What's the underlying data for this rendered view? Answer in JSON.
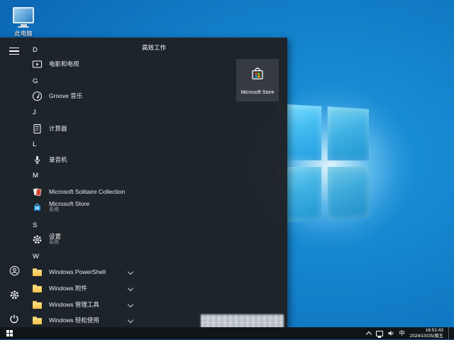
{
  "desktop": {
    "this_pc_label": "此电脑"
  },
  "start_menu": {
    "sections": [
      "D",
      "G",
      "J",
      "L",
      "M",
      "S",
      "W"
    ],
    "apps": {
      "movies": {
        "label": "电影和电视"
      },
      "groove": {
        "label": "Groove 音乐"
      },
      "calculator": {
        "label": "计算器"
      },
      "recorder": {
        "label": "录音机"
      },
      "solitaire": {
        "label": "Microsoft Solitaire Collection"
      },
      "store": {
        "label": "Microsoft Store",
        "sub": "系统"
      },
      "settings": {
        "label": "设置",
        "sub": "系统"
      },
      "powershell": {
        "label": "Windows PowerShell"
      },
      "accessories": {
        "label": "Windows 附件"
      },
      "admin_tools": {
        "label": "Windows 管理工具"
      },
      "ease_of_access": {
        "label": "Windows 轻松使用"
      }
    },
    "right_pane": {
      "group_title": "高效工作",
      "tiles": [
        {
          "label": "Microsoft Store"
        }
      ]
    }
  },
  "taskbar": {
    "tray": {
      "ime_label": "中",
      "time": "16:51:43",
      "date": "2024/10/25/周五"
    }
  },
  "colors": {
    "accent": "#0078d7",
    "wallpaper_blue": "#0f74c0",
    "folder_yellow": "#f8d068",
    "store_red": "#f25022",
    "store_green": "#7fba00",
    "store_blue": "#00a4ef",
    "store_yellow": "#ffb900"
  }
}
